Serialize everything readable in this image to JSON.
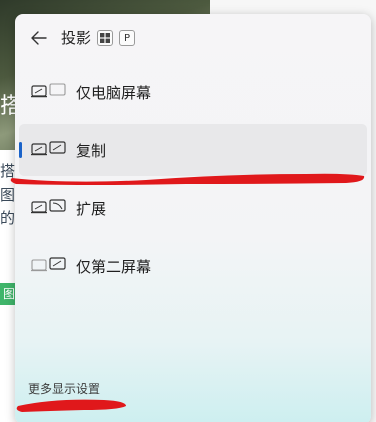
{
  "background": {
    "chars": [
      "搭",
      "搭",
      "图",
      "的，"
    ],
    "green_label": "图"
  },
  "flyout": {
    "title": "投影",
    "shortcut_keys": [
      "P"
    ],
    "items": [
      {
        "label": "仅电脑屏幕",
        "icon": "pc-screen-only-icon"
      },
      {
        "label": "复制",
        "icon": "duplicate-icon",
        "selected": true
      },
      {
        "label": "扩展",
        "icon": "extend-icon"
      },
      {
        "label": "仅第二屏幕",
        "icon": "second-screen-only-icon"
      }
    ],
    "footer_link": "更多显示设置"
  },
  "colors": {
    "accent": "#1a63c9",
    "scribble": "#e0181b"
  }
}
